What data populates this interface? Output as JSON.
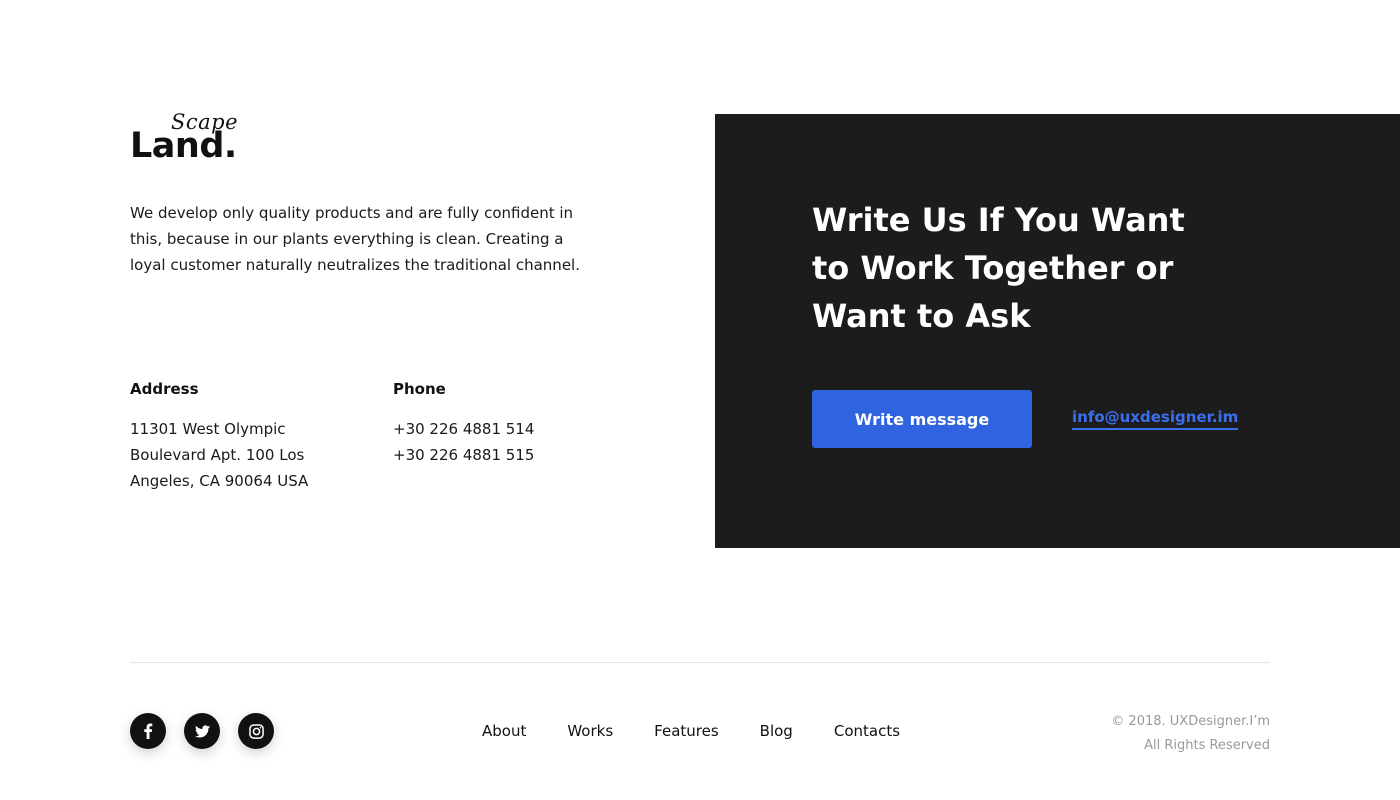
{
  "brand": {
    "logo_top": "Scape",
    "logo_bottom": "Land."
  },
  "intro": {
    "text": "We develop only quality products and are fully confident in this, because in our plants everything is clean. Creating a loyal customer naturally neutralizes the traditional channel."
  },
  "contact": {
    "address_label": "Address",
    "address_value": "11301 West Olympic Boulevard Apt. 100 Los Angeles, CA 90064 USA",
    "phone_label": "Phone",
    "phones": [
      "+30 226 4881 514",
      "+30 226 4881 515"
    ]
  },
  "cta": {
    "heading": "Write Us If You Want to Work Together or Want to Ask",
    "button_label": "Write message",
    "email": "info@uxdesigner.im",
    "panel_color": "#1c1c1c",
    "button_color": "#2f63e0",
    "link_color": "#3a6ff0"
  },
  "footer": {
    "socials": [
      {
        "icon": "facebook-icon"
      },
      {
        "icon": "twitter-icon"
      },
      {
        "icon": "instagram-icon"
      }
    ],
    "nav": [
      "About",
      "Works",
      "Features",
      "Blog",
      "Contacts"
    ],
    "copyright_line1": "© 2018. UXDesigner.I’m",
    "copyright_line2": "All Rights Reserved"
  }
}
